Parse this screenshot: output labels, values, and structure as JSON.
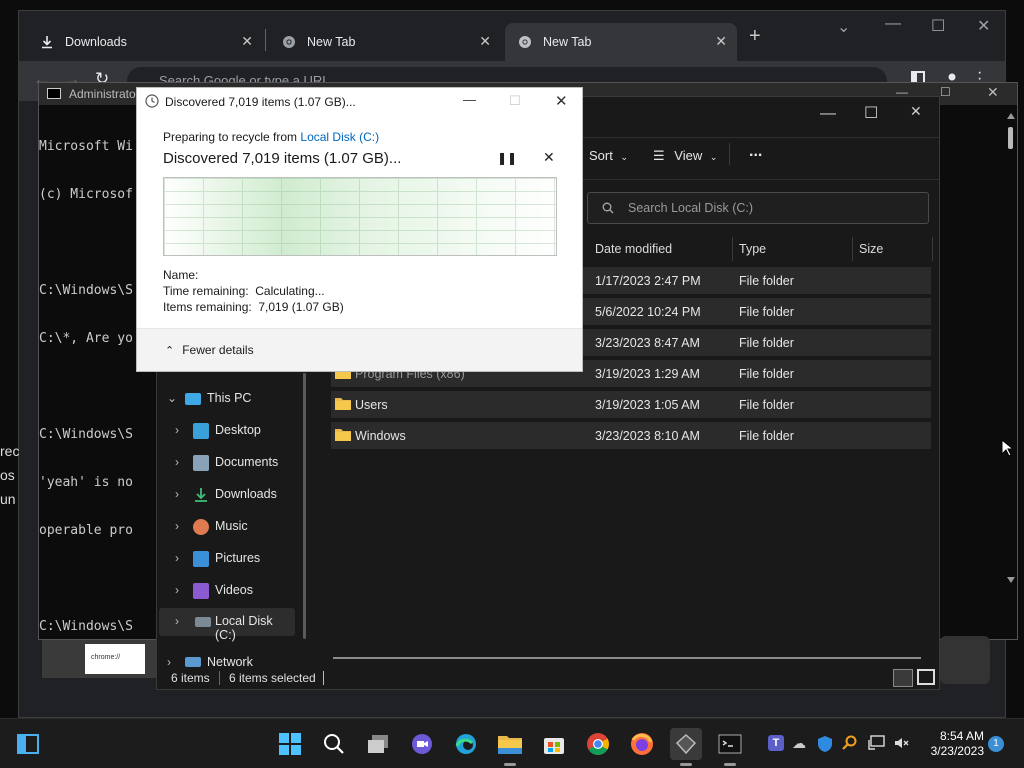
{
  "chrome": {
    "tabs": [
      {
        "label": "Downloads",
        "icon": "download-icon"
      },
      {
        "label": "New Tab",
        "icon": "chrome-icon"
      },
      {
        "label": "New Tab",
        "icon": "chrome-icon"
      }
    ],
    "omnibox_placeholder": "Search Google or type a URL"
  },
  "terminal": {
    "title": "Administrator",
    "lines": [
      "Microsoft Wi",
      "(c) Microsof",
      "",
      "C:\\Windows\\S",
      "C:\\*, Are yo",
      "",
      "C:\\Windows\\S",
      "'yeah' is no",
      "operable pro",
      "",
      "C:\\Windows\\S"
    ],
    "left_fragments": [
      "rec",
      "os",
      "un"
    ]
  },
  "explorer": {
    "toolbar": {
      "sort": "Sort",
      "view": "View",
      "more": "..."
    },
    "search_placeholder": "Search Local Disk (C:)",
    "columns": {
      "date": "Date modified",
      "type": "Type",
      "size": "Size"
    },
    "rows": [
      {
        "name": "",
        "date": "1/17/2023 2:47 PM",
        "type": "File folder"
      },
      {
        "name": "",
        "date": "5/6/2022 10:24 PM",
        "type": "File folder"
      },
      {
        "name": "",
        "date": "3/23/2023 8:47 AM",
        "type": "File folder"
      },
      {
        "name": "Program Files (x86)",
        "date": "3/19/2023 1:29 AM",
        "type": "File folder"
      },
      {
        "name": "Users",
        "date": "3/19/2023 1:05 AM",
        "type": "File folder"
      },
      {
        "name": "Windows",
        "date": "3/23/2023 8:10 AM",
        "type": "File folder"
      }
    ],
    "nav": {
      "this_pc": "This PC",
      "items": [
        "Desktop",
        "Documents",
        "Downloads",
        "Music",
        "Pictures",
        "Videos",
        "Local Disk (C:)"
      ],
      "network": "Network"
    },
    "status": {
      "items": "6 items",
      "selected": "6 items selected"
    }
  },
  "dialog": {
    "title": "Discovered 7,019 items (1.07 GB)...",
    "preparing": "Preparing to recycle from",
    "location_link": "Local Disk (C:)",
    "heading": "Discovered 7,019 items (1.07 GB)...",
    "name_label": "Name:",
    "time_label": "Time remaining:",
    "time_value": "Calculating...",
    "items_label": "Items remaining:",
    "items_value": "7,019 (1.07 GB)",
    "fewer_details": "Fewer details"
  },
  "taskbar": {
    "time": "8:54 AM",
    "date": "3/23/2023",
    "notification_count": "1",
    "thumbnail_label": "chrome://"
  },
  "colors": {
    "accent": "#0078d4",
    "folder": "#f0c040",
    "link": "#0067c0"
  }
}
